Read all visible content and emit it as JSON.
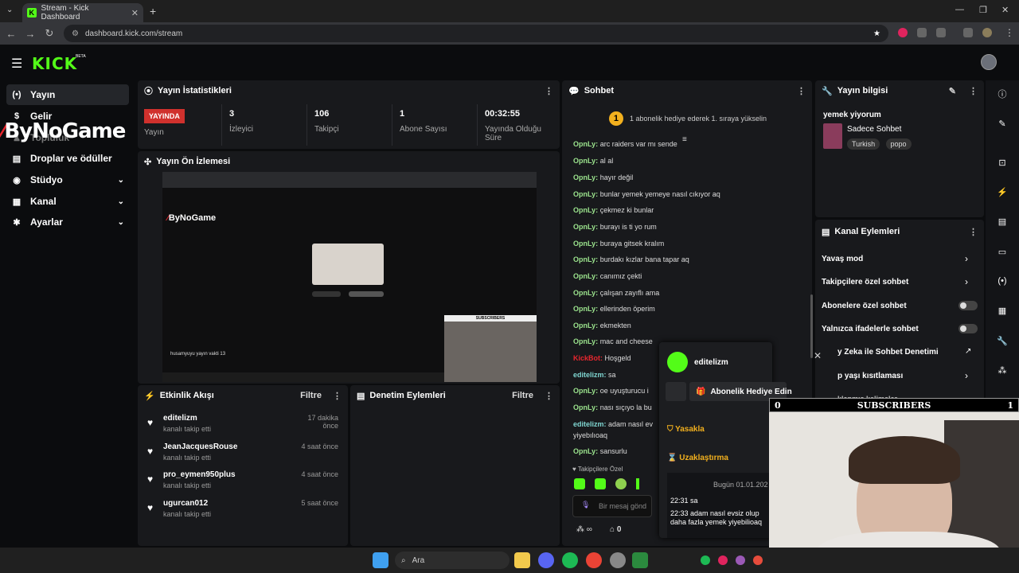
{
  "browser": {
    "tab_title": "Stream - Kick Dashboard",
    "tab_favicon": "K",
    "new_tab": "+",
    "url": "dashboard.kick.com/stream"
  },
  "header": {
    "logo": "KICK",
    "beta": "BETA"
  },
  "sidebar": {
    "items": [
      {
        "label": "Yayın",
        "icon": "(•)"
      },
      {
        "label": "Gelir",
        "icon": "$"
      },
      {
        "label": "Topluluk",
        "icon": "♟"
      },
      {
        "label": "Droplar ve ödüller",
        "icon": "▤"
      },
      {
        "label": "Stüdyo",
        "icon": "◉"
      },
      {
        "label": "Kanal",
        "icon": "▦"
      },
      {
        "label": "Ayarlar",
        "icon": "✱"
      }
    ],
    "watermark": "ByNoGame"
  },
  "stats": {
    "title": "Yayın İstatistikleri",
    "live_label": "YAYINDA",
    "live_sub": "Yayın",
    "items": [
      {
        "value": "3",
        "label": "İzleyici"
      },
      {
        "value": "106",
        "label": "Takipçi"
      },
      {
        "value": "1",
        "label": "Abone Sayısı"
      },
      {
        "value": "00:32:55",
        "label": "Yayında Olduğu Süre"
      }
    ]
  },
  "preview": {
    "title": "Yayın Ön İzlemesi",
    "inner_logo": "ByNoGame",
    "inner_caption": "husamyuyu yayın vakti 13",
    "subs_label": "SUBSCRIBERS"
  },
  "activity": {
    "title": "Etkinlik Akışı",
    "filter": "Filtre",
    "items": [
      {
        "name": "editelizm",
        "sub": "kanalı takip etti",
        "time": "17 dakika önce"
      },
      {
        "name": "JeanJacquesRouse",
        "sub": "kanalı takip etti",
        "time": "4 saat önce"
      },
      {
        "name": "pro_eymen950plus",
        "sub": "kanalı takip etti",
        "time": "4 saat önce"
      },
      {
        "name": "ugurcan012",
        "sub": "kanalı takip etti",
        "time": "5 saat önce"
      }
    ]
  },
  "moderation": {
    "title": "Denetim Eylemleri",
    "filter": "Filtre"
  },
  "chat": {
    "title": "Sohbet",
    "pinned_count": "1",
    "pinned_text": "1 abonelik hediye ederek 1. sıraya yükselin",
    "messages": [
      {
        "user": "OpnLy:",
        "text": "arc raiders var mı sende"
      },
      {
        "user": "OpnLy:",
        "text": "al al"
      },
      {
        "user": "OpnLy:",
        "text": "hayır değil"
      },
      {
        "user": "OpnLy:",
        "text": "bunlar yemek yemeye nasıl cıkıyor aq"
      },
      {
        "user": "OpnLy:",
        "text": "çekmez ki bunlar"
      },
      {
        "user": "OpnLy:",
        "text": "burayı is ti yo rum"
      },
      {
        "user": "OpnLy:",
        "text": "buraya gitsek kralım"
      },
      {
        "user": "OpnLy:",
        "text": "burdakı kızlar bana tapar aq"
      },
      {
        "user": "OpnLy:",
        "text": "canımız çekti"
      },
      {
        "user": "OpnLy:",
        "text": "çalışan zayıflı ama"
      },
      {
        "user": "OpnLy:",
        "text": "ellerinden öperim"
      },
      {
        "user": "OpnLy:",
        "text": "ekmekten"
      },
      {
        "user": "OpnLy:",
        "text": "mac and cheese"
      },
      {
        "user": "KickBot:",
        "text": "Hoşgeld"
      },
      {
        "user": "editelizm:",
        "text": "sa"
      },
      {
        "user": "OpnLy:",
        "text": "oe uyuşturucu i"
      },
      {
        "user": "OpnLy:",
        "text": "nası sıçıyo la bu"
      },
      {
        "user": "editelizm:",
        "text": "adam nasıl ev"
      },
      {
        "user": "",
        "text": "yiyebılıoaq"
      },
      {
        "user": "OpnLy:",
        "text": "sansurlu"
      }
    ],
    "followers_only": "Takipçilere Özel",
    "placeholder": "Bir mesaj gönd",
    "infinity": "∞",
    "shop_count": "0"
  },
  "stream_info": {
    "title": "Yayın bilgisi",
    "stream_title": "yemek yiyorum",
    "category": "Sadece Sohbet",
    "tags": [
      "Turkish",
      "popo"
    ]
  },
  "channel_actions": {
    "title": "Kanal Eylemleri",
    "rows": [
      {
        "label": "Yavaş mod",
        "kind": "arrow"
      },
      {
        "label": "Takipçilere özel sohbet",
        "kind": "arrow"
      },
      {
        "label": "Abonelere özel sohbet",
        "kind": "toggle"
      },
      {
        "label": "Yalnızca ifadelerle sohbet",
        "kind": "toggle"
      },
      {
        "label": "y Zeka ile Sohbet Denetimi",
        "kind": "external"
      },
      {
        "label": "p yaşı kısıtlaması",
        "kind": "arrow"
      },
      {
        "label": "klanmış kelimeler",
        "kind": "arrow"
      }
    ]
  },
  "user_popup": {
    "username": "editelizm",
    "gift_button": "Abonelik Hediye Edin",
    "ban": "Yasakla",
    "timeout": "Uzaklaştırma",
    "date_divider": "Bugün 01.01.202",
    "log": [
      "22:31 sa",
      "22:33 adam nasıl evsiz olup daha fazla yemek yiyebilioaq"
    ]
  },
  "overlay": {
    "subs_left": "0",
    "subs_label": "SUBSCRIBERS",
    "subs_right": "1"
  },
  "taskbar": {
    "search": "Ara"
  },
  "colors": {
    "kick_green": "#53fc18",
    "live_red": "#d0312d",
    "panel": "#18191c"
  }
}
